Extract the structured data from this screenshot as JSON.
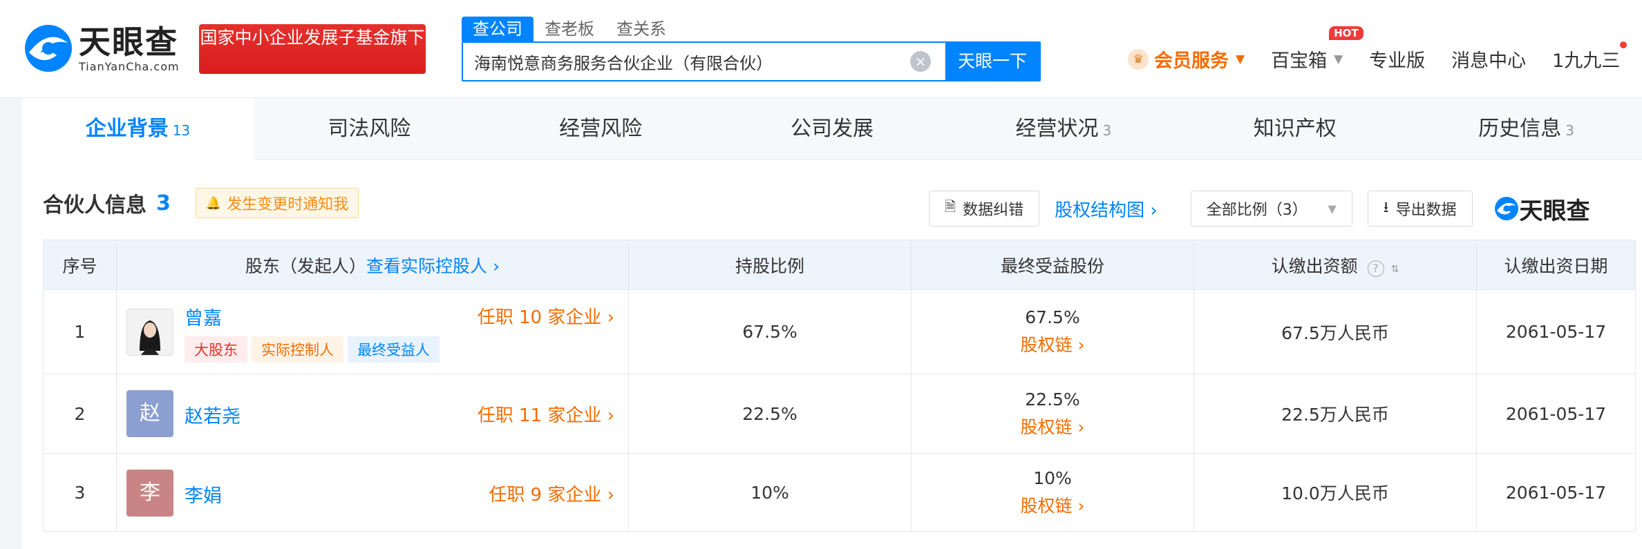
{
  "header": {
    "logo_cn": "天眼查",
    "logo_en": "TianYanCha.com",
    "badge_text": "国家中小企业发展子基金旗下",
    "search_tabs": [
      "查公司",
      "查老板",
      "查关系"
    ],
    "search_value": "海南悦意商务服务合伙企业（有限合伙）",
    "search_button": "天眼一下",
    "vip_label": "会员服务",
    "baobao_label": "百宝箱",
    "hot_label": "HOT",
    "pro_label": "专业版",
    "messages_label": "消息中心",
    "user_label": "1九九三"
  },
  "tabs": [
    {
      "label": "企业背景",
      "count": "13"
    },
    {
      "label": "司法风险",
      "count": ""
    },
    {
      "label": "经营风险",
      "count": ""
    },
    {
      "label": "公司发展",
      "count": ""
    },
    {
      "label": "经营状况",
      "count": "3"
    },
    {
      "label": "知识产权",
      "count": ""
    },
    {
      "label": "历史信息",
      "count": "3"
    }
  ],
  "section": {
    "title": "合伙人信息",
    "count": "3",
    "notify": "发生变更时通知我",
    "correct_btn": "数据纠错",
    "structure_link": "股权结构图",
    "ratio_select": "全部比例（3）",
    "export_btn": "导出数据",
    "watermark": "天眼查"
  },
  "table": {
    "headers": {
      "index": "序号",
      "holder": "股东（发起人）",
      "actual_link": "查看实际控股人",
      "ratio": "持股比例",
      "final": "最终受益股份",
      "capital": "认缴出资额",
      "date": "认缴出资日期"
    },
    "rows": [
      {
        "index": "1",
        "name": "曾嘉",
        "avatar": "",
        "avatar_color": "#ffffff",
        "posts": "任职 10 家企业",
        "tags": [
          "大股东",
          "实际控制人",
          "最终受益人"
        ],
        "ratio": "67.5%",
        "final": "67.5%",
        "chain": "股权链",
        "capital": "67.5万人民币",
        "date": "2061-05-17"
      },
      {
        "index": "2",
        "name": "赵若尧",
        "avatar": "赵",
        "avatar_color": "#8b9fd1",
        "posts": "任职 11 家企业",
        "tags": [],
        "ratio": "22.5%",
        "final": "22.5%",
        "chain": "股权链",
        "capital": "22.5万人民币",
        "date": "2061-05-17"
      },
      {
        "index": "3",
        "name": "李娟",
        "avatar": "李",
        "avatar_color": "#c98585",
        "posts": "任职 9 家企业",
        "tags": [],
        "ratio": "10%",
        "final": "10%",
        "chain": "股权链",
        "capital": "10.0万人民币",
        "date": "2061-05-17"
      }
    ]
  },
  "colors": {
    "brand": "#0084ff",
    "accent": "#f76b00",
    "badge": "#e5302d"
  }
}
